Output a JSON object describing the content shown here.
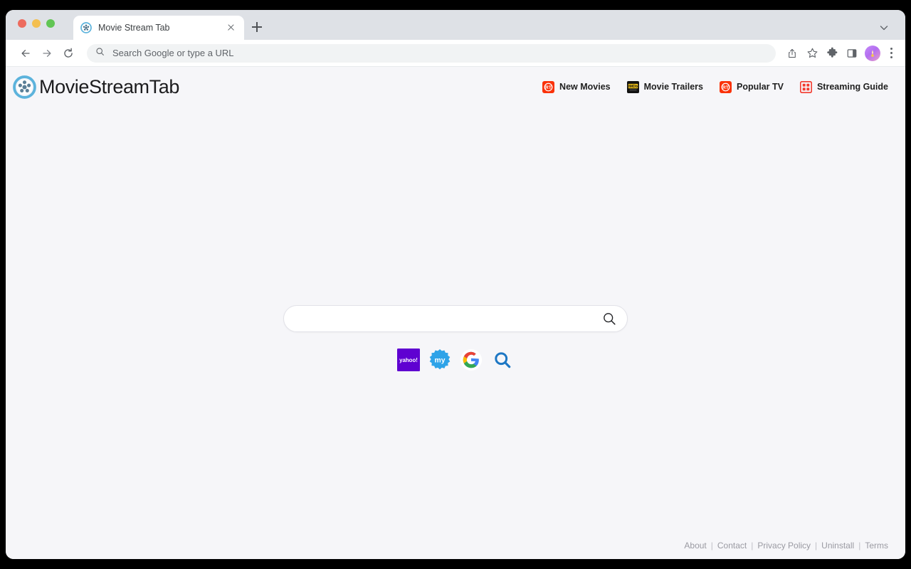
{
  "browser": {
    "tab": {
      "title": "Movie Stream Tab",
      "favicon": "film-reel-icon",
      "close_label": "×"
    },
    "new_tab_label": "+",
    "omnibox": {
      "placeholder": "Search Google or type a URL",
      "value": "",
      "icon": "search-icon"
    },
    "toolbar_icons": [
      "back-icon",
      "forward-icon",
      "reload-icon",
      "share-icon",
      "bookmark-star-icon",
      "extensions-puzzle-icon",
      "side-panel-icon",
      "profile-avatar-icon",
      "browser-menu-icon"
    ]
  },
  "header": {
    "brand": {
      "name": "MovieStreamTab",
      "logo": "film-reel-icon",
      "logo_color": "#5cb3dc"
    },
    "nav": [
      {
        "label": "New Movies",
        "icon": "rotten-tomatoes-icon",
        "color": "#fa320a"
      },
      {
        "label": "Movie Trailers",
        "icon": "imdb-icon",
        "color": "#f5c518"
      },
      {
        "label": "Popular TV",
        "icon": "rotten-tomatoes-icon",
        "color": "#fa320a"
      },
      {
        "label": "Streaming Guide",
        "icon": "grid-icon",
        "color": "#f33a2e"
      }
    ]
  },
  "search": {
    "placeholder": "",
    "value": "",
    "submit_icon": "search-icon",
    "engines": [
      {
        "name": "yahoo",
        "label": "yahoo!",
        "icon": "yahoo-icon",
        "color": "#5f01d1"
      },
      {
        "name": "myway",
        "label": "my",
        "icon": "myway-icon",
        "color": "#2ea3e8"
      },
      {
        "name": "google",
        "label": "G",
        "icon": "google-icon",
        "color": "#4285f4"
      },
      {
        "name": "ask",
        "label": "",
        "icon": "magnifier-icon",
        "color": "#1d77c4"
      }
    ]
  },
  "footer": {
    "links": [
      "About",
      "Contact",
      "Privacy Policy",
      "Uninstall",
      "Terms"
    ],
    "separator": "|"
  },
  "colors": {
    "page_background": "#f6f6f9",
    "tabstrip": "#dee1e6",
    "toolbar": "#ffffff",
    "text": "#1f1f1f",
    "muted": "#9a9aa2"
  }
}
